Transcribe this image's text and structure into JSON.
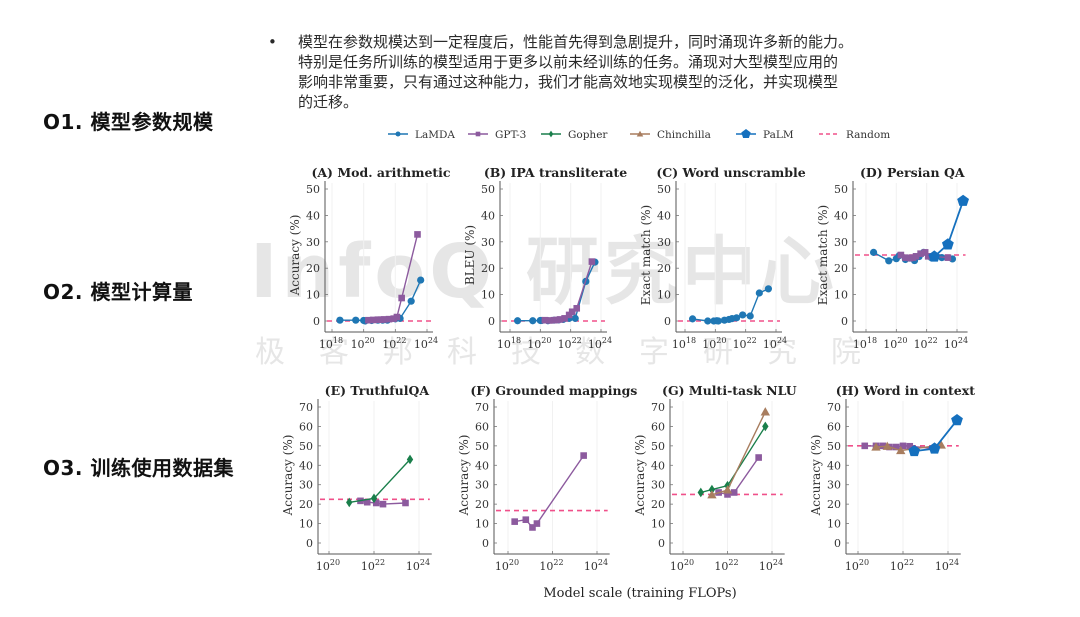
{
  "side_labels": [
    "O1. 模型参数规模",
    "O2. 模型计算量",
    "O3. 训练使用数据集"
  ],
  "bullet": {
    "symbol": "•",
    "text": "模型在参数规模达到一定程度后，性能首先得到急剧提升，同时涌现许多新的能力。\n特别是任务所训练的模型适用于更多以前未经训练的任务。涌现对大型模型应用的\n影响非常重要，只有通过这种能力，我们才能高效地实现模型的泛化，并实现模型\n的迁移。"
  },
  "watermark": {
    "main": "InfoQ 研究中心",
    "sub": "极客邦科技数字研究院"
  },
  "colors": {
    "LaMDA": "#1f77b4",
    "GPT-3": "#8c5a9e",
    "Gopher": "#1a7f4b",
    "Chinchilla": "#a87d5f",
    "PaLM": "#1570be",
    "Random": "#f0508a"
  },
  "chart_data": {
    "type": "line",
    "xlabel": "Model scale (training FLOPs)",
    "x_scale": "log10",
    "legend": {
      "placement": "top-center",
      "entries": [
        {
          "name": "LaMDA",
          "marker": "circle",
          "dashed": false
        },
        {
          "name": "GPT-3",
          "marker": "square",
          "dashed": false
        },
        {
          "name": "Gopher",
          "marker": "diamond",
          "dashed": false
        },
        {
          "name": "Chinchilla",
          "marker": "triangle",
          "dashed": false
        },
        {
          "name": "PaLM",
          "marker": "pentagon",
          "dashed": false
        },
        {
          "name": "Random",
          "marker": "none",
          "dashed": true
        }
      ]
    },
    "panels": [
      {
        "id": "A",
        "title": "(A) Mod. arithmetic",
        "ylabel": "Accuracy (%)",
        "xlim": [
          18,
          24
        ],
        "xticks": [
          18,
          20,
          22,
          24
        ],
        "ylim": [
          0,
          50
        ],
        "yticks": [
          0,
          10,
          20,
          30,
          40,
          50
        ],
        "random": 0,
        "series": [
          {
            "name": "LaMDA",
            "x": [
              18.5,
              19.5,
              20.0,
              20.1,
              20.5,
              20.9,
              21.2,
              21.5,
              22.0,
              22.3,
              23.0,
              23.6
            ],
            "y": [
              0.3,
              0.3,
              0.2,
              0.0,
              0.2,
              0.3,
              0.3,
              0.3,
              0.8,
              1.0,
              7.5,
              15.5
            ]
          },
          {
            "name": "GPT-3",
            "x": [
              20.3,
              20.6,
              20.9,
              21.1,
              21.3,
              21.6,
              21.9,
              22.1,
              22.4,
              23.4
            ],
            "y": [
              0.3,
              0.4,
              0.5,
              0.5,
              0.6,
              0.7,
              0.9,
              1.5,
              8.7,
              32.8
            ]
          }
        ]
      },
      {
        "id": "B",
        "title": "(B) IPA transliterate",
        "ylabel": "BLEU (%)",
        "xlim": [
          18,
          24
        ],
        "xticks": [
          18,
          20,
          22,
          24
        ],
        "ylim": [
          0,
          50
        ],
        "yticks": [
          0,
          10,
          20,
          30,
          40,
          50
        ],
        "random": 0,
        "series": [
          {
            "name": "LaMDA",
            "x": [
              18.5,
              19.5,
              20.0,
              20.1,
              20.5,
              20.9,
              21.2,
              21.5,
              21.9,
              22.3,
              23.0,
              23.6
            ],
            "y": [
              0.1,
              0.1,
              0.2,
              0.2,
              0.1,
              0.3,
              0.4,
              0.6,
              1.0,
              1.0,
              15.0,
              22.3
            ]
          },
          {
            "name": "GPT-3",
            "x": [
              20.3,
              20.6,
              20.9,
              21.1,
              21.3,
              21.6,
              21.9,
              22.1,
              22.4,
              23.4
            ],
            "y": [
              0.3,
              0.2,
              0.3,
              0.4,
              0.6,
              1.0,
              2.3,
              3.5,
              4.8,
              22.5
            ]
          }
        ]
      },
      {
        "id": "C",
        "title": "(C) Word unscramble",
        "ylabel": "Exact match (%)",
        "xlim": [
          18,
          24
        ],
        "xticks": [
          18,
          20,
          22,
          24
        ],
        "ylim": [
          0,
          50
        ],
        "yticks": [
          0,
          10,
          20,
          30,
          40,
          50
        ],
        "random": 0,
        "series": [
          {
            "name": "LaMDA",
            "x": [
              18.5,
              19.5,
              19.9,
              20.1,
              20.2,
              20.6,
              20.9,
              21.1,
              21.4,
              21.8,
              22.3,
              22.9,
              23.5
            ],
            "y": [
              0.8,
              0.0,
              0.0,
              0.1,
              0.0,
              0.3,
              0.6,
              0.9,
              1.2,
              2.3,
              1.9,
              10.6,
              12.2
            ]
          }
        ]
      },
      {
        "id": "D",
        "title": "(D) Persian QA",
        "ylabel": "Exact match (%)",
        "xlim": [
          18,
          24.3
        ],
        "xticks": [
          18,
          20,
          22,
          24
        ],
        "ylim": [
          0,
          50
        ],
        "yticks": [
          0,
          10,
          20,
          30,
          40,
          50
        ],
        "random": 25,
        "series": [
          {
            "name": "LaMDA",
            "x": [
              18.5,
              19.5,
              20.0,
              20.2,
              20.6,
              20.9,
              21.2,
              21.5,
              21.8,
              22.3,
              23.0,
              23.7
            ],
            "y": [
              26.0,
              22.8,
              23.6,
              24.8,
              23.3,
              23.8,
              22.9,
              24.4,
              26.0,
              24.0,
              24.0,
              23.5
            ]
          },
          {
            "name": "GPT-3",
            "x": [
              20.3,
              20.6,
              20.9,
              21.1,
              21.3,
              21.6,
              21.9,
              22.1,
              22.4,
              23.4
            ],
            "y": [
              25.0,
              24.0,
              23.8,
              24.0,
              24.5,
              25.5,
              26.0,
              24.5,
              24.5,
              24.0
            ]
          },
          {
            "name": "PaLM",
            "x": [
              22.5,
              23.4,
              24.4
            ],
            "y": [
              24.4,
              29.0,
              45.5
            ]
          }
        ]
      },
      {
        "id": "E",
        "title": "(E) TruthfulQA",
        "ylabel": "Accuracy (%)",
        "xlim": [
          19.5,
          24.3
        ],
        "xticks": [
          20,
          22,
          24
        ],
        "ylim": [
          0,
          70
        ],
        "yticks": [
          0,
          10,
          20,
          30,
          40,
          50,
          60,
          70
        ],
        "random": 22.5,
        "series": [
          {
            "name": "GPT-3",
            "x": [
              21.4,
              21.7,
              22.1,
              22.4,
              23.4
            ],
            "y": [
              21.7,
              21.0,
              20.6,
              20.0,
              20.6
            ]
          },
          {
            "name": "Gopher",
            "x": [
              20.9,
              22.0,
              23.6
            ],
            "y": [
              20.9,
              23.0,
              43.0
            ]
          }
        ]
      },
      {
        "id": "F",
        "title": "(F) Grounded mappings",
        "ylabel": "Accuracy (%)",
        "xlim": [
          19.5,
          24.3
        ],
        "xticks": [
          20,
          22,
          24
        ],
        "ylim": [
          0,
          70
        ],
        "yticks": [
          0,
          10,
          20,
          30,
          40,
          50,
          60,
          70
        ],
        "random": 16.7,
        "series": [
          {
            "name": "GPT-3",
            "x": [
              20.3,
              20.8,
              21.1,
              21.3,
              23.4
            ],
            "y": [
              11.0,
              12.0,
              8.0,
              10.0,
              45.0
            ]
          }
        ]
      },
      {
        "id": "G",
        "title": "(G) Multi-task NLU",
        "ylabel": "Accuracy (%)",
        "xlim": [
          19.5,
          24.3
        ],
        "xticks": [
          20,
          22,
          24
        ],
        "ylim": [
          0,
          70
        ],
        "yticks": [
          0,
          10,
          20,
          30,
          40,
          50,
          60,
          70
        ],
        "random": 25,
        "series": [
          {
            "name": "GPT-3",
            "x": [
              21.6,
              22.0,
              22.3,
              23.4
            ],
            "y": [
              26.0,
              25.0,
              26.0,
              44.0
            ]
          },
          {
            "name": "Gopher",
            "x": [
              20.8,
              21.3,
              22.0,
              23.7
            ],
            "y": [
              26.0,
              27.5,
              29.5,
              60.0
            ]
          },
          {
            "name": "Chinchilla",
            "x": [
              21.3,
              22.0,
              23.7
            ],
            "y": [
              24.8,
              27.3,
              67.5
            ]
          }
        ]
      },
      {
        "id": "H",
        "title": "(H) Word in context",
        "ylabel": "Accuracy (%)",
        "xlim": [
          19.5,
          24.3
        ],
        "xticks": [
          20,
          22,
          24
        ],
        "ylim": [
          0,
          70
        ],
        "yticks": [
          0,
          10,
          20,
          30,
          40,
          50,
          60,
          70
        ],
        "random": 50,
        "series": [
          {
            "name": "GPT-3",
            "x": [
              20.3,
              20.8,
              21.1,
              21.4,
              21.7,
              22.0,
              22.3,
              23.4
            ],
            "y": [
              50.0,
              50.0,
              50.0,
              49.4,
              49.4,
              50.0,
              49.8,
              48.6
            ]
          },
          {
            "name": "Chinchilla",
            "x": [
              20.8,
              21.3,
              21.9,
              23.7
            ],
            "y": [
              49.4,
              49.8,
              47.6,
              50.4
            ]
          },
          {
            "name": "PaLM",
            "x": [
              22.5,
              23.4,
              24.4
            ],
            "y": [
              47.3,
              48.6,
              63.2
            ]
          }
        ]
      }
    ]
  }
}
